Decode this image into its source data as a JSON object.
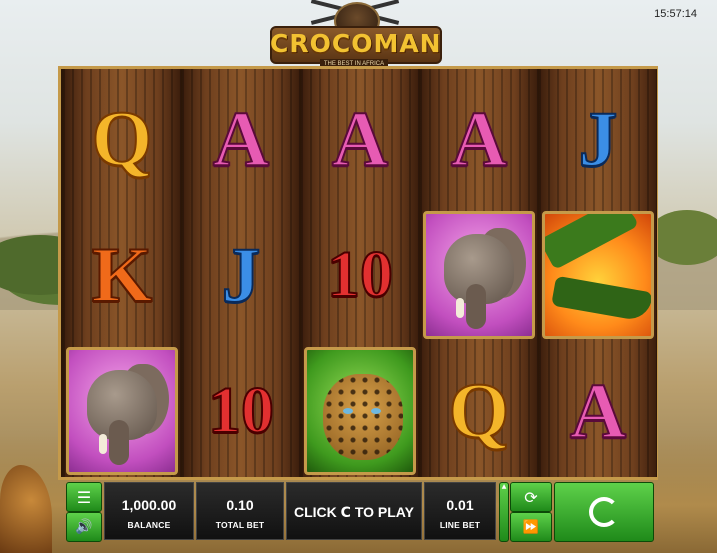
{
  "clock": "15:57:14",
  "logo": {
    "title": "CROCOMAN",
    "subtitle": "THE BEST IN AFRICA"
  },
  "reels": [
    [
      {
        "kind": "letter",
        "label": "Q",
        "sym": "Q"
      },
      {
        "kind": "letter",
        "label": "K",
        "sym": "K"
      },
      {
        "kind": "picture",
        "label": "elephant",
        "sym": "elephant"
      }
    ],
    [
      {
        "kind": "letter",
        "label": "A",
        "sym": "A"
      },
      {
        "kind": "letter",
        "label": "J",
        "sym": "J"
      },
      {
        "kind": "letter",
        "label": "10",
        "sym": "10"
      }
    ],
    [
      {
        "kind": "letter",
        "label": "A",
        "sym": "A"
      },
      {
        "kind": "letter",
        "label": "10",
        "sym": "10"
      },
      {
        "kind": "picture",
        "label": "leopard",
        "sym": "leopard"
      }
    ],
    [
      {
        "kind": "letter",
        "label": "A",
        "sym": "A"
      },
      {
        "kind": "picture",
        "label": "elephant",
        "sym": "elephant"
      },
      {
        "kind": "letter",
        "label": "Q",
        "sym": "Q"
      }
    ],
    [
      {
        "kind": "letter",
        "label": "J",
        "sym": "J"
      },
      {
        "kind": "picture",
        "label": "crocodile",
        "sym": "croc"
      },
      {
        "kind": "letter",
        "label": "A",
        "sym": "A"
      }
    ]
  ],
  "controls": {
    "menu_icon": "menu-icon",
    "sound_icon": "speaker-icon",
    "balance_value": "1,000.00",
    "balance_label": "BALANCE",
    "total_bet_value": "0.10",
    "total_bet_label": "TOTAL BET",
    "play_prefix": "CLICK",
    "play_icon": "C",
    "play_suffix": "TO PLAY",
    "line_bet_value": "0.01",
    "line_bet_label": "LINE BET",
    "autoplay_icon": "refresh-icon",
    "fast_icon": "fast-forward-icon",
    "spin_icon": "spin-icon"
  },
  "colors": {
    "accent_green": "#1f8a1a",
    "frame_gold": "#c59a4a",
    "panel_dark": "#111111"
  }
}
